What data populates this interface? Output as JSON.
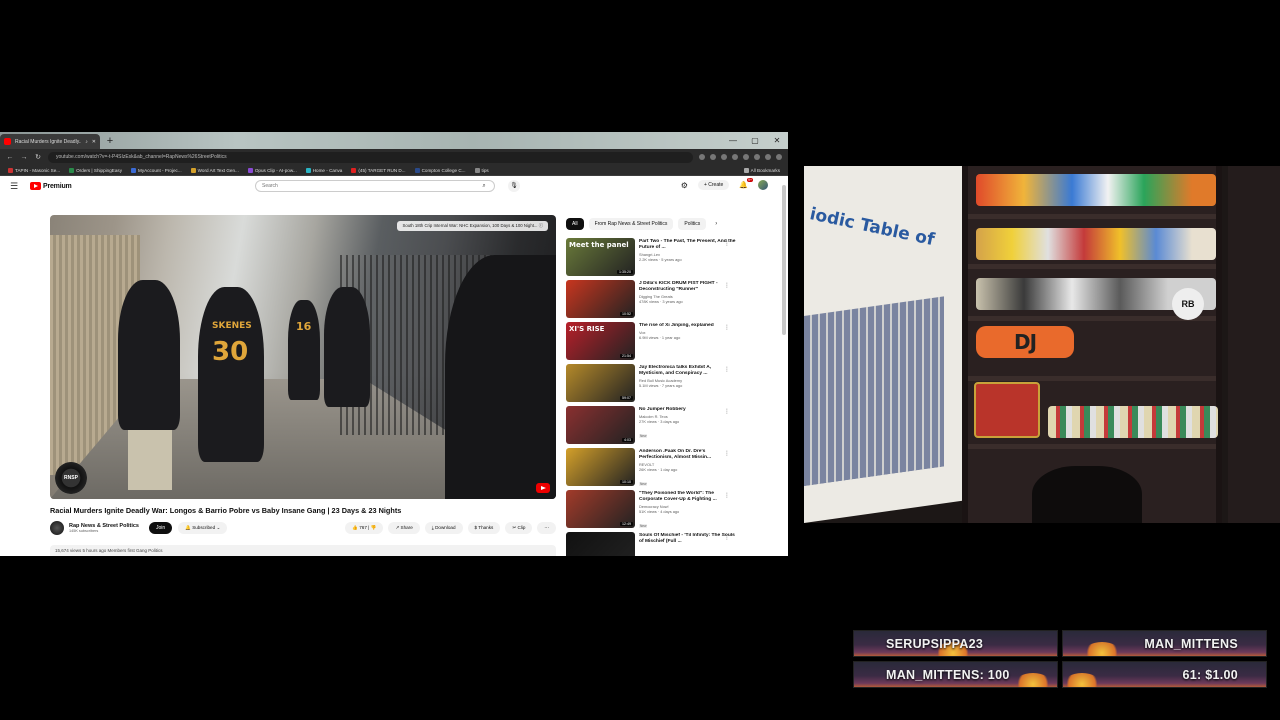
{
  "browser": {
    "tab_title": "Racial Murders Ignite Deadly...",
    "url": "youtube.com/watch?v=-t-P4SIzEsk&ab_channel=RapNews%26StreetPolitics",
    "bookmarks": [
      "TAPIN - Masonic Se...",
      "Orders | ShippingEasy",
      "MyAccount - Projec...",
      "Word Art Text Gen...",
      "Opus Clip - AI-pow...",
      "Home - Canva",
      "(45) TARGET RUN D...",
      "Compton College C...",
      "tips"
    ],
    "all_bookmarks": "All Bookmarks"
  },
  "youtube": {
    "logo_text": "Premium",
    "search_placeholder": "Search",
    "create_label": "Create",
    "notif_count": "9+",
    "video_chip": "South 18th Crip Internal War: NHC Expansion, 100 Days & 100 Night...",
    "watermark": "RNSP",
    "title": "Racial Murders Ignite Deadly War: Longos & Barrio Pobre vs Baby Insane Gang | 23 Days & 23 Nights",
    "channel": {
      "name": "Rap News & Street Politics",
      "subs": "145K subscribers",
      "join": "Join",
      "subscribed": "Subscribed"
    },
    "actions": {
      "likes": "767",
      "share": "Share",
      "download": "Download",
      "thanks": "Thanks",
      "clip": "Clip"
    },
    "desc": "15,674 views  5 hours ago  Members first  Gang Politics",
    "chips": [
      "All",
      "From Rap News & Street Politics",
      "Politics"
    ],
    "recs": [
      {
        "title": "Part Two - The Past, The Present, And the Future of ...",
        "channel": "Shangri-Lex",
        "meta": "2.2K views · 5 years ago",
        "duration": "1:35:20",
        "thumb_text": "Meet the panel",
        "thumb_color": "#6a7a3a"
      },
      {
        "title": "J Dilla's KICK DRUM FIST FIGHT - Deconstructing \"Runner\"",
        "channel": "Digging The Greats",
        "meta": "478K views · 3 years ago",
        "duration": "10:52",
        "thumb_text": "",
        "thumb_color": "#c8361f"
      },
      {
        "title": "The rise of Xi Jinping, explained",
        "channel": "Vox",
        "meta": "6.9M views · 1 year ago",
        "duration": "21:54",
        "thumb_text": "XI'S RISE",
        "thumb_color": "#b8202a"
      },
      {
        "title": "Jay Electronica talks Exhibit A, Mysticism, and Conspiracy ...",
        "channel": "Red Bull Music Academy",
        "meta": "5.1M views · 7 years ago",
        "duration": "59:07",
        "thumb_text": "",
        "thumb_color": "#b58a2a"
      },
      {
        "title": "No Jumper Robbery",
        "channel": "Malcolm R. Teos",
        "meta": "27K views · 3 days ago",
        "duration": "4:03",
        "thumb_text": "",
        "thumb_color": "#8a3030",
        "badge": "New"
      },
      {
        "title": "Anderson .Paak On Dr. Dre's Perfectionism, Almost Missin...",
        "channel": "REVOLT",
        "meta": "26K views · 1 day ago",
        "duration": "10:10",
        "thumb_text": "",
        "thumb_color": "#d4a02a",
        "badge": "New"
      },
      {
        "title": "\"They Poisoned the World\": The Corporate Cover-Up & Fighting ...",
        "channel": "Democracy Now!",
        "meta": "51K views · 4 days ago",
        "duration": "12:49",
        "thumb_text": "",
        "thumb_color": "#a23b2a",
        "badge": "New"
      },
      {
        "title": "Souls Of Mischief - 'Til Infinity: The Souls of Mischief (Full ...",
        "channel": "",
        "meta": "",
        "duration": "",
        "thumb_text": "",
        "thumb_color": "#111"
      }
    ]
  },
  "overlay": {
    "left_top": "SERUPSIPPA23",
    "right_top": "MAN_MITTENS",
    "left_bottom": "MAN_MITTENS: 100",
    "right_bottom": "61: $1.00"
  },
  "webcam": {
    "poster_title": "iodic Table of",
    "graffiti": "DJ",
    "rb_badge": "RB"
  }
}
